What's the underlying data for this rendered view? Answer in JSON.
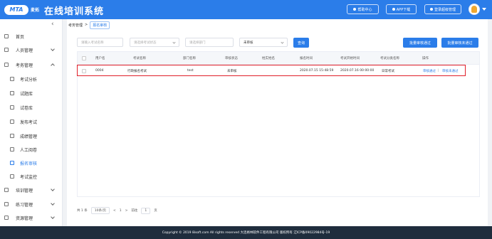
{
  "header": {
    "logo_text": "MTA",
    "logo_sub": "麦拓",
    "app_title": "在线培训系统",
    "help_label": "帮助中心",
    "app_download_label": "APP下载",
    "user_label": "登录超级管理"
  },
  "sidebar": {
    "items": [
      {
        "label": "首页"
      },
      {
        "label": "人员管理"
      },
      {
        "label": "考务管理"
      },
      {
        "label": "考试分析"
      },
      {
        "label": "试题库"
      },
      {
        "label": "试卷库"
      },
      {
        "label": "发布考试"
      },
      {
        "label": "成绩管理"
      },
      {
        "label": "人工阅卷"
      },
      {
        "label": "报名审核"
      },
      {
        "label": "考试监控"
      },
      {
        "label": "培训管理"
      },
      {
        "label": "练习管理"
      },
      {
        "label": "资源管理"
      }
    ]
  },
  "breadcrumb": {
    "parent": "考务管理",
    "separator": ">",
    "current": "报名审核"
  },
  "filters": {
    "user_placeholder": "请输入考试名称",
    "exam_placeholder": "请选择考试状态",
    "dept_placeholder": "请选择部门",
    "status_value": "未审核",
    "search_label": "查询",
    "batch_approve_label": "批量审核通过",
    "batch_reject_label": "批量审核未通过"
  },
  "table": {
    "columns": [
      "用户名",
      "考试名称",
      "部门名称",
      "审核状态",
      "姓实姓名",
      "报名时间",
      "考试开始时间",
      "考试分类名称",
      "操作"
    ],
    "rows": [
      {
        "username": "0004",
        "exam_name": "行政报名考试",
        "dept": "test",
        "status": "未审核",
        "real_name": "",
        "signup_time": "2020.07.15 15:48:59",
        "start_time": "2020.07.16 00:00:00",
        "category": "日常考试",
        "action_approve": "审核通过",
        "action_sep": "|",
        "action_reject": "审核未通过"
      }
    ]
  },
  "pager": {
    "total": "共 1 条",
    "page_size": "10条/页",
    "prev": "<",
    "page": "1",
    "next": ">",
    "goto_label": "前往",
    "goto_value": "1",
    "page_unit": "页"
  },
  "footer": {
    "copyright": "Copyright © 2019 8isoft.com All rights reserved 大连格林软件工程有限公司 版权所有 辽ICP备09022984号-19"
  },
  "colors": {
    "primary": "#2b7de9",
    "highlight_border": "#e0202a",
    "footer_bg": "#1f2d3d"
  }
}
